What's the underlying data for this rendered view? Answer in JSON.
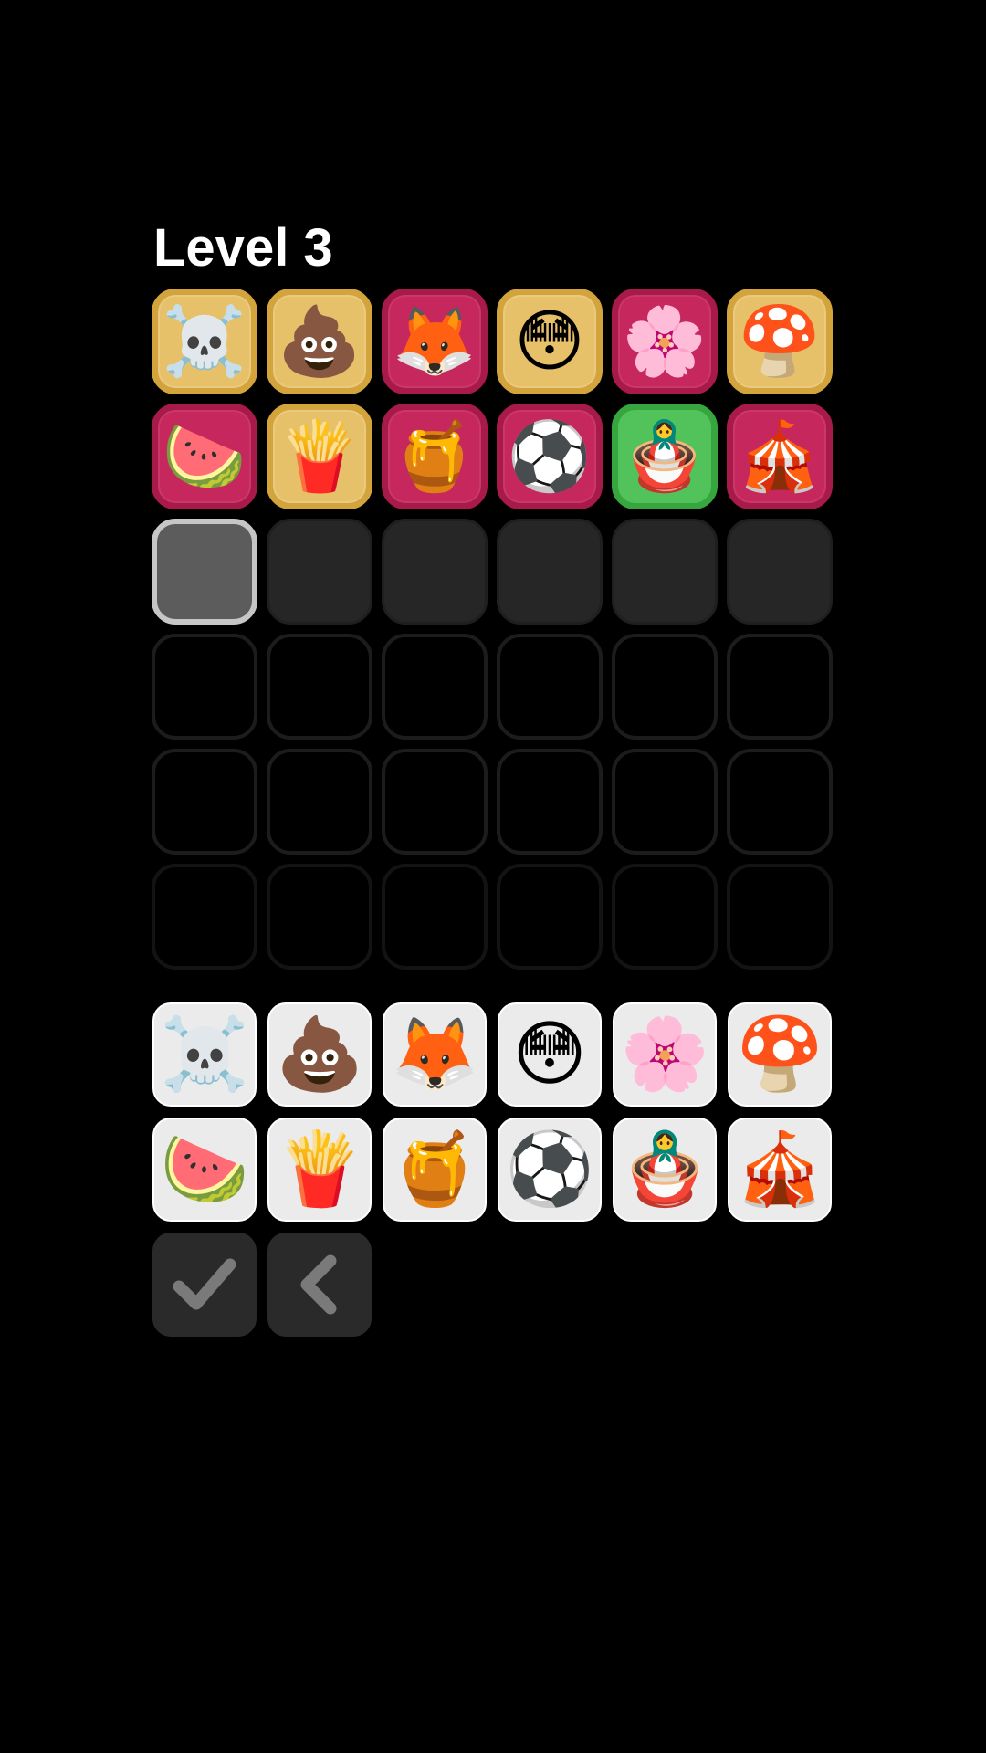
{
  "level_title": "Level 3",
  "colors": {
    "background": "#000000",
    "tile_yellow": "#e7c06a",
    "tile_red": "#c6285e",
    "tile_green": "#52c35a",
    "key_background": "#ebebeb",
    "action_key_background": "#2a2a2a"
  },
  "board": {
    "rows": [
      [
        {
          "emoji": "☠️",
          "state": "yellow"
        },
        {
          "emoji": "💩",
          "state": "yellow"
        },
        {
          "emoji": "🦊",
          "state": "red"
        },
        {
          "emoji": "😳",
          "state": "yellow"
        },
        {
          "emoji": "🌸",
          "state": "red"
        },
        {
          "emoji": "🍄",
          "state": "yellow"
        }
      ],
      [
        {
          "emoji": "🍉",
          "state": "red"
        },
        {
          "emoji": "🍟",
          "state": "yellow"
        },
        {
          "emoji": "🍯",
          "state": "red"
        },
        {
          "emoji": "⚽",
          "state": "red"
        },
        {
          "emoji": "🪆",
          "state": "green"
        },
        {
          "emoji": "🎪",
          "state": "red"
        }
      ]
    ],
    "current_row_cells": 6,
    "empty_rows": 3,
    "columns": 6
  },
  "keyboard": {
    "keys": [
      {
        "emoji": "☠️",
        "name": "skull"
      },
      {
        "emoji": "💩",
        "name": "pile-of-poo"
      },
      {
        "emoji": "🦊",
        "name": "fox"
      },
      {
        "emoji": "😳",
        "name": "flushed-face"
      },
      {
        "emoji": "🌸",
        "name": "cherry-blossom"
      },
      {
        "emoji": "🍄",
        "name": "mushroom"
      },
      {
        "emoji": "🍉",
        "name": "watermelon"
      },
      {
        "emoji": "🍟",
        "name": "french-fries"
      },
      {
        "emoji": "🍯",
        "name": "honey-pot"
      },
      {
        "emoji": "⚽",
        "name": "soccer-ball"
      },
      {
        "emoji": "🪆",
        "name": "nesting-dolls"
      },
      {
        "emoji": "🎪",
        "name": "circus-tent"
      }
    ],
    "actions": [
      {
        "name": "submit",
        "icon": "checkmark-icon"
      },
      {
        "name": "backspace",
        "icon": "chevron-left-icon"
      }
    ]
  }
}
